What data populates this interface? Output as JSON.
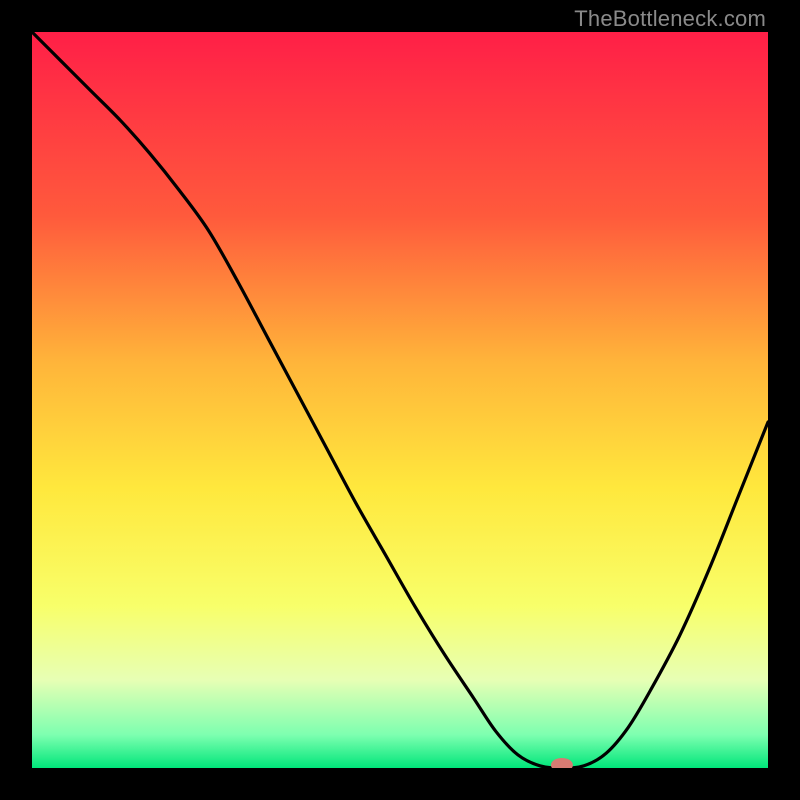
{
  "watermark": "TheBottleneck.com",
  "chart_data": {
    "type": "line",
    "title": "",
    "xlabel": "",
    "ylabel": "",
    "xlim": [
      0,
      100
    ],
    "ylim": [
      0,
      100
    ],
    "grid": false,
    "legend": false,
    "gradient_stops": [
      {
        "offset": 0.0,
        "color": "#ff1f47"
      },
      {
        "offset": 0.25,
        "color": "#ff5a3c"
      },
      {
        "offset": 0.45,
        "color": "#ffb53a"
      },
      {
        "offset": 0.62,
        "color": "#ffe83d"
      },
      {
        "offset": 0.78,
        "color": "#f8ff6a"
      },
      {
        "offset": 0.88,
        "color": "#e7ffb4"
      },
      {
        "offset": 0.955,
        "color": "#7dffb0"
      },
      {
        "offset": 1.0,
        "color": "#00e67a"
      }
    ],
    "series": [
      {
        "name": "bottleneck-curve",
        "x": [
          0,
          4,
          8,
          12,
          16,
          20,
          24,
          28,
          32,
          36,
          40,
          44,
          48,
          52,
          56,
          60,
          63,
          66,
          69,
          72,
          75,
          78,
          81,
          84,
          88,
          92,
          96,
          100
        ],
        "y": [
          100,
          96,
          92,
          88,
          83.5,
          78.5,
          73,
          66,
          58.5,
          51,
          43.5,
          36,
          29,
          22,
          15.5,
          9.5,
          5,
          1.8,
          0.3,
          0,
          0.3,
          2,
          5.5,
          10.5,
          18,
          27,
          37,
          47
        ]
      }
    ],
    "marker": {
      "name": "optimum-marker",
      "x": 72,
      "y": 0,
      "color": "#d87b73",
      "rx": 11,
      "ry": 7
    }
  }
}
